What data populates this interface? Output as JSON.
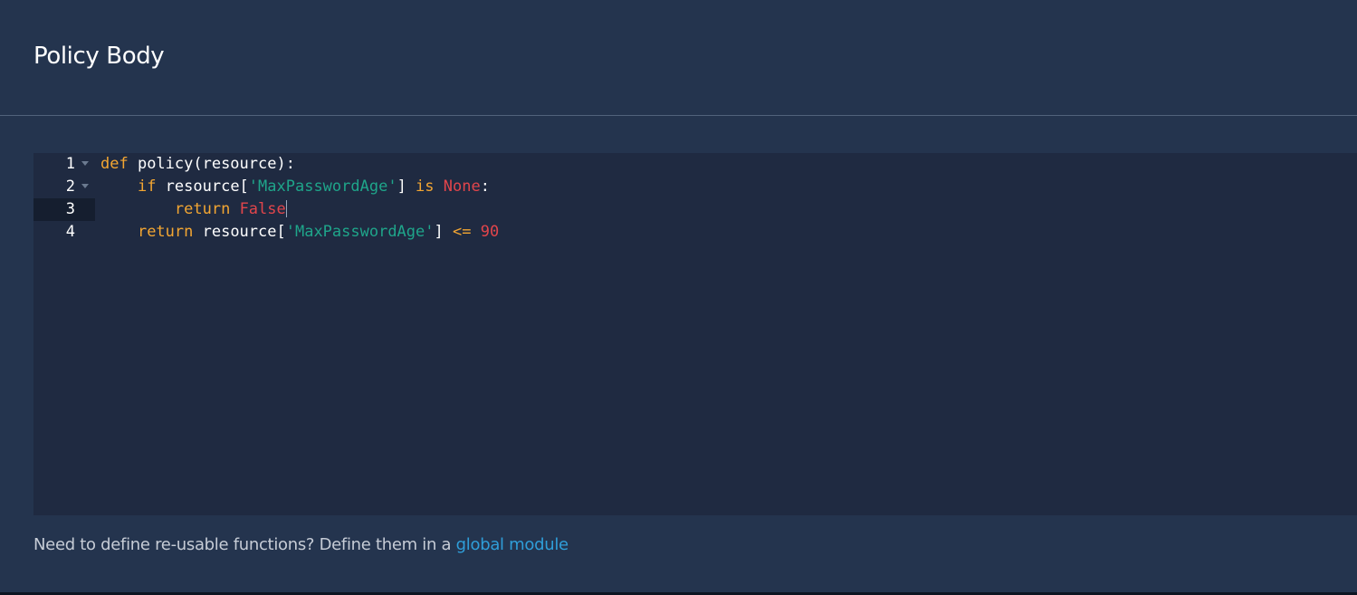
{
  "header": {
    "title": "Policy Body"
  },
  "editor": {
    "active_line": 3,
    "lines": [
      {
        "number": "1",
        "foldable": true,
        "tokens": [
          {
            "t": "def",
            "c": "kw"
          },
          {
            "t": " policy(resource):",
            "c": "plain"
          }
        ]
      },
      {
        "number": "2",
        "foldable": true,
        "tokens": [
          {
            "t": "    ",
            "c": "plain"
          },
          {
            "t": "if",
            "c": "kw"
          },
          {
            "t": " resource[",
            "c": "plain"
          },
          {
            "t": "'MaxPasswordAge'",
            "c": "str"
          },
          {
            "t": "] ",
            "c": "plain"
          },
          {
            "t": "is",
            "c": "kw"
          },
          {
            "t": " ",
            "c": "plain"
          },
          {
            "t": "None",
            "c": "const"
          },
          {
            "t": ":",
            "c": "plain"
          }
        ]
      },
      {
        "number": "3",
        "foldable": false,
        "cursor": true,
        "tokens": [
          {
            "t": "        ",
            "c": "plain"
          },
          {
            "t": "return",
            "c": "kw"
          },
          {
            "t": " ",
            "c": "plain"
          },
          {
            "t": "False",
            "c": "const"
          }
        ]
      },
      {
        "number": "4",
        "foldable": false,
        "tokens": [
          {
            "t": "    ",
            "c": "plain"
          },
          {
            "t": "return",
            "c": "kw"
          },
          {
            "t": " resource[",
            "c": "plain"
          },
          {
            "t": "'MaxPasswordAge'",
            "c": "str"
          },
          {
            "t": "] ",
            "c": "plain"
          },
          {
            "t": "<=",
            "c": "op"
          },
          {
            "t": " ",
            "c": "plain"
          },
          {
            "t": "90",
            "c": "num-lit"
          }
        ]
      }
    ]
  },
  "footer": {
    "help_text": "Need to define re-usable functions? Define them in a ",
    "link_text": "global module"
  },
  "colors": {
    "panel_background": "#24344e",
    "editor_background": "#1f2a41",
    "keyword": "#f3a632",
    "string": "#1fa58a",
    "constant": "#e2454b",
    "link": "#2f9ed9"
  }
}
